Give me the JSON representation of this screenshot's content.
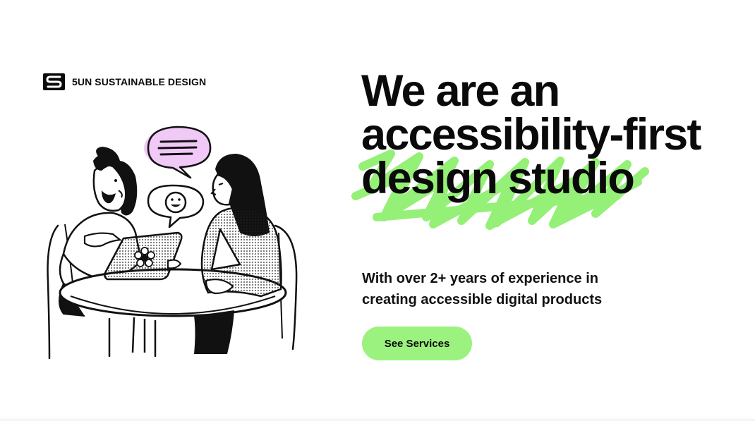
{
  "brand": {
    "name": "5UN SUSTAINABLE DESIGN",
    "logo_icon": "s-logo-icon"
  },
  "hero": {
    "headline_line1": "We are an",
    "headline_line2": "accessibility-first",
    "headline_line3": "design studio",
    "subtext_line1": "With over 2+ years of experience in",
    "subtext_line2": "creating accessible digital products",
    "cta_label": "See Services"
  },
  "colors": {
    "accent_green": "#9cf27e",
    "highlight_green": "#8ff06f",
    "bubble_pink": "#f0c9f6",
    "text": "#0a0a0a"
  }
}
